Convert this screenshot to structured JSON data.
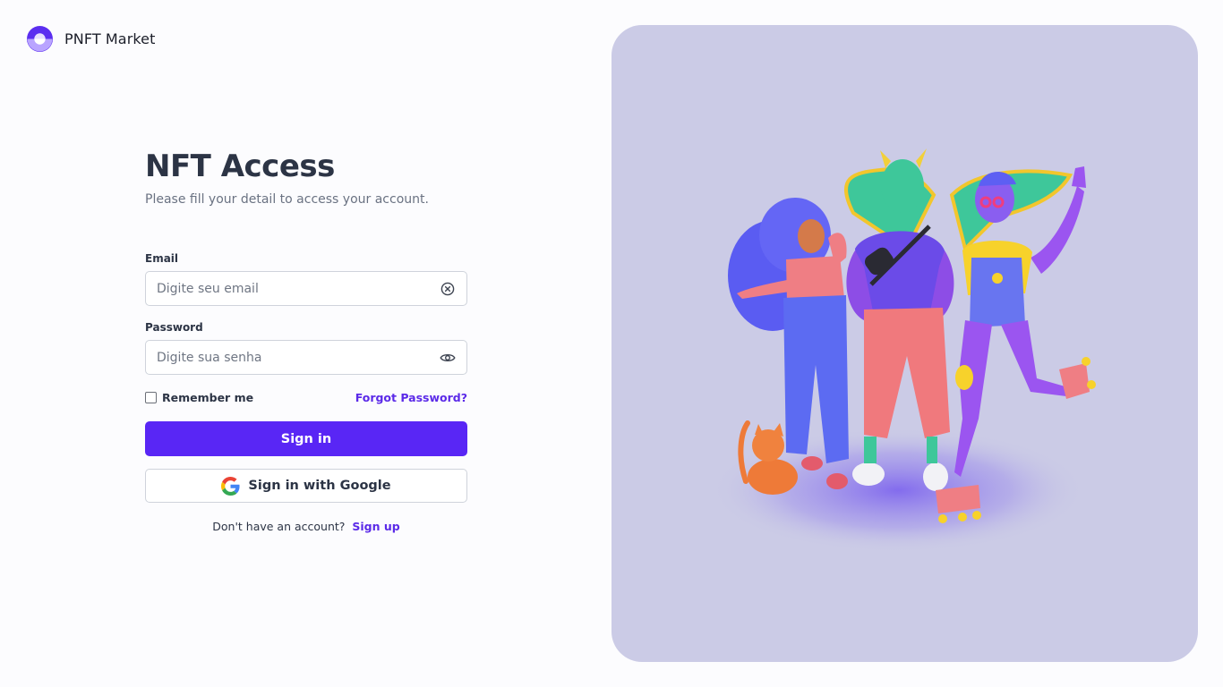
{
  "brand": {
    "name": "PNFT Market",
    "logo_icon": "ring-logo-icon",
    "accent": "#5926f5"
  },
  "login": {
    "title": "NFT Access",
    "subtitle": "Please fill your detail to access your account.",
    "email": {
      "label": "Email",
      "placeholder": "Digite seu email",
      "value": "",
      "action_icon": "clear-circle-icon"
    },
    "password": {
      "label": "Password",
      "placeholder": "Digite sua senha",
      "value": "",
      "action_icon": "eye-icon"
    },
    "remember_label": "Remember me",
    "remember_checked": false,
    "forgot_label": "Forgot Password?",
    "signin_label": "Sign in",
    "google_label": "Sign in with Google",
    "google_icon": "google-g-icon",
    "no_account_text": "Don't have an account?",
    "signup_label": "Sign up"
  },
  "hero": {
    "background": "#cbcbe6",
    "illustration": "3d-nft-characters-illustration"
  }
}
